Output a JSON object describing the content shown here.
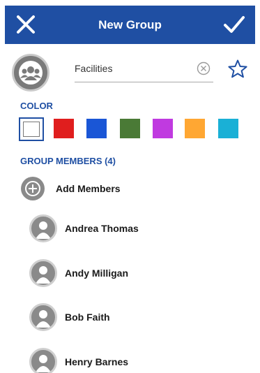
{
  "header": {
    "title": "New Group",
    "close_icon": "close-icon",
    "confirm_icon": "checkmark-icon",
    "background": "#1f4fa3"
  },
  "group": {
    "avatar_icon": "group-icon",
    "name_value": "Facilities",
    "clear_icon": "clear-circle-icon",
    "favorite_icon": "star-outline-icon"
  },
  "color": {
    "label": "COLOR",
    "selected": "#ffffff",
    "options": [
      "#ffffff",
      "#e01e1e",
      "#1a56d6",
      "#4a7a36",
      "#c03ae0",
      "#ffa733",
      "#1ab0d6"
    ]
  },
  "members": {
    "label": "GROUP MEMBERS (4)",
    "add_label": "Add Members",
    "list": [
      {
        "name": "Andrea Thomas",
        "avatar_icon": "person-icon"
      },
      {
        "name": "Andy Milligan",
        "avatar_icon": "person-icon"
      },
      {
        "name": "Bob Faith",
        "avatar_icon": "person-icon"
      },
      {
        "name": "Henry Barnes",
        "avatar_icon": "person-icon"
      }
    ]
  }
}
